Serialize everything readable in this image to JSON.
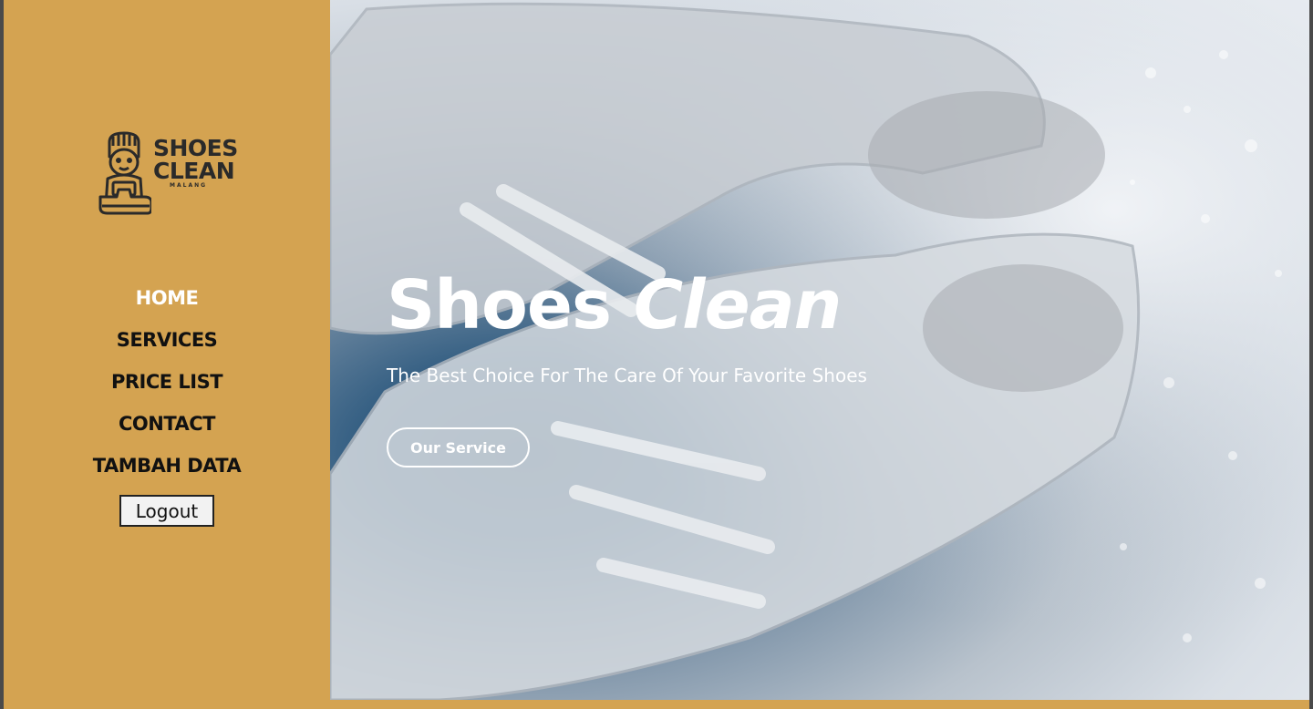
{
  "brand": {
    "logo_line1": "SHOES",
    "logo_line2": "CLEAN",
    "logo_sub": "MALANG",
    "logo_color": "#2a2a2a"
  },
  "sidebar": {
    "background": "#d4a351",
    "nav": [
      {
        "label": "HOME",
        "active": true
      },
      {
        "label": "SERVICES",
        "active": false
      },
      {
        "label": "PRICE LIST",
        "active": false
      },
      {
        "label": "CONTACT",
        "active": false
      },
      {
        "label": "TAMBAH DATA",
        "active": false
      }
    ],
    "logout_label": "Logout"
  },
  "hero": {
    "title_plain": "Shoes",
    "title_italic": "Clean",
    "subtitle": "The Best Choice For The Care Of Your Favorite Shoes",
    "cta_label": "Our Service",
    "image": "white-sneakers-in-soap-foam"
  }
}
